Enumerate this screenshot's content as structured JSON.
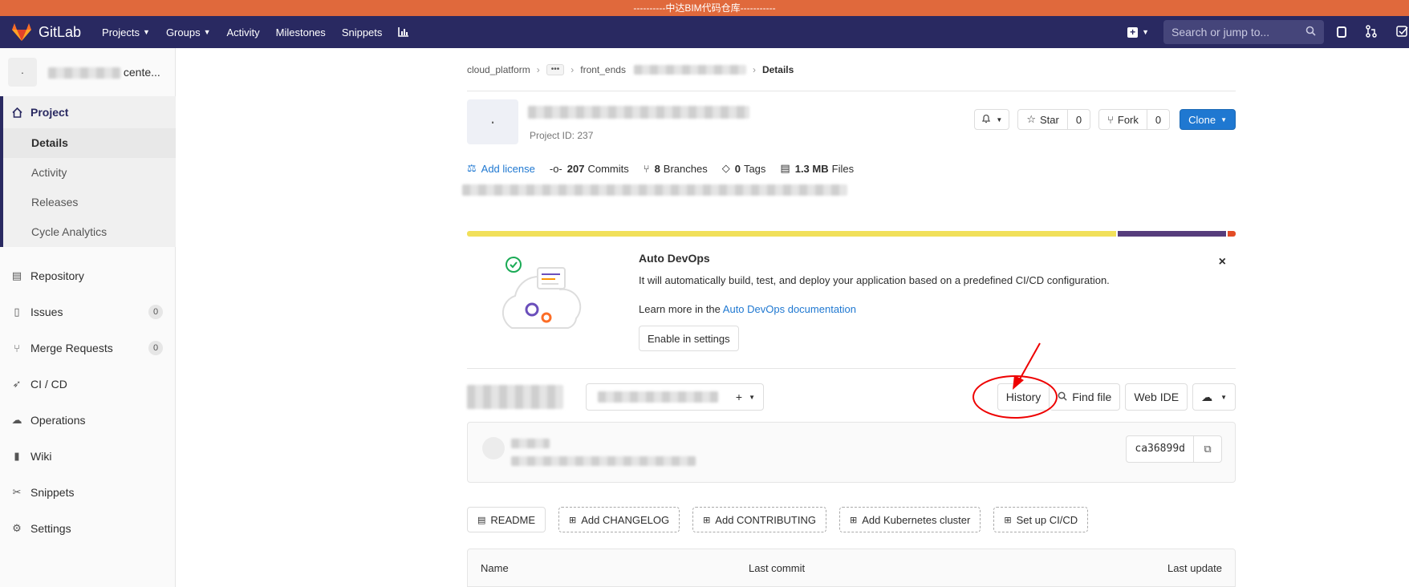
{
  "banner": {
    "text": "----------中达BIM代码仓库-----------"
  },
  "navbar": {
    "brand": "GitLab",
    "items": [
      {
        "label": "Projects",
        "dropdown": true
      },
      {
        "label": "Groups",
        "dropdown": true
      },
      {
        "label": "Activity",
        "dropdown": false
      },
      {
        "label": "Milestones",
        "dropdown": false
      },
      {
        "label": "Snippets",
        "dropdown": false
      }
    ],
    "search_placeholder": "Search or jump to..."
  },
  "sidebar": {
    "project_name_suffix": "cente...",
    "project_section": "Project",
    "project_subitems": [
      "Details",
      "Activity",
      "Releases",
      "Cycle Analytics"
    ],
    "items": [
      {
        "label": "Repository",
        "icon": "doc-icon"
      },
      {
        "label": "Issues",
        "icon": "issues-icon",
        "count": "0"
      },
      {
        "label": "Merge Requests",
        "icon": "merge-icon",
        "count": "0"
      },
      {
        "label": "CI / CD",
        "icon": "rocket-icon"
      },
      {
        "label": "Operations",
        "icon": "cloud-gear-icon"
      },
      {
        "label": "Wiki",
        "icon": "book-icon"
      },
      {
        "label": "Snippets",
        "icon": "scissors-icon"
      },
      {
        "label": "Settings",
        "icon": "gear-icon"
      }
    ]
  },
  "breadcrumb": {
    "root": "cloud_platform",
    "ellipsis": "•••",
    "group": "front_ends",
    "current": "Details"
  },
  "project": {
    "id_label": "Project ID: 237",
    "notify_icon": "bell-icon",
    "star_label": "Star",
    "star_count": "0",
    "fork_label": "Fork",
    "fork_count": "0",
    "clone_label": "Clone"
  },
  "stats": {
    "add_license": "Add license",
    "commits_count": "207",
    "commits_label": "Commits",
    "branches_count": "8",
    "branches_label": "Branches",
    "tags_count": "0",
    "tags_label": "Tags",
    "size": "1.3 MB",
    "files_label": "Files"
  },
  "language_bar": [
    {
      "fraction": 0.848,
      "color": "#f1e05a"
    },
    {
      "fraction": 0.142,
      "color": "#563d7c"
    },
    {
      "fraction": 0.01,
      "color": "#e34c26"
    }
  ],
  "devops": {
    "title": "Auto DevOps",
    "text": "It will automatically build, test, and deploy your application based on a predefined CI/CD configuration.",
    "learn_prefix": "Learn more in the ",
    "learn_link": "Auto DevOps documentation",
    "button": "Enable in settings",
    "close": "×"
  },
  "toolbar": {
    "history": "History",
    "find_file": "Find file",
    "web_ide": "Web IDE"
  },
  "commit": {
    "sha": "ca36899d"
  },
  "add_buttons": [
    "README",
    "Add CHANGELOG",
    "Add CONTRIBUTING",
    "Add Kubernetes cluster",
    "Set up CI/CD"
  ],
  "table": {
    "col_name": "Name",
    "col_commit": "Last commit",
    "col_update": "Last update"
  },
  "colors": {
    "navbar": "#292961",
    "banner": "#e0693c",
    "primary": "#1f78d1",
    "annotation": "#e00000"
  }
}
